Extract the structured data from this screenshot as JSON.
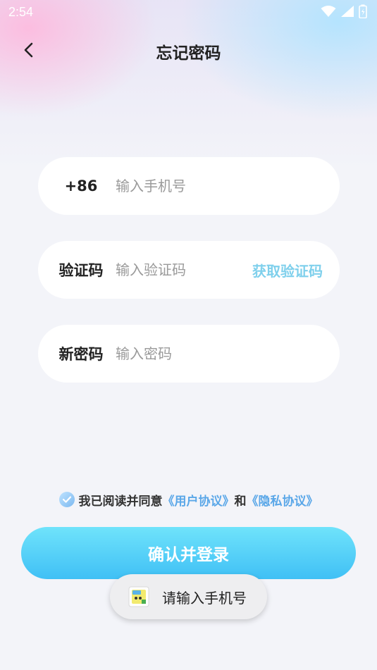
{
  "status_bar": {
    "time": "2:54",
    "icons": [
      "wifi-icon",
      "signal-icon",
      "battery-icon"
    ]
  },
  "header": {
    "back_icon": "chevron-left-icon",
    "title": "忘记密码"
  },
  "phone_field": {
    "prefix": "+86",
    "placeholder": "输入手机号",
    "value": ""
  },
  "code_field": {
    "label": "验证码",
    "placeholder": "输入验证码",
    "value": "",
    "action_label": "获取验证码"
  },
  "password_field": {
    "label": "新密码",
    "placeholder": "输入密码",
    "value": ""
  },
  "agreement": {
    "checked": true,
    "prefix": "我已阅读并同意",
    "user_agreement": "《用户协议》",
    "and": "和",
    "privacy_agreement": "《隐私协议》"
  },
  "submit": {
    "label": "确认并登录"
  },
  "toast": {
    "icon": "app-logo-icon",
    "message": "请输入手机号"
  },
  "colors": {
    "accent": "#40c0f5",
    "link": "#5aa7e8",
    "get_code": "#7fd0ec",
    "background": "#f3f4f9"
  }
}
